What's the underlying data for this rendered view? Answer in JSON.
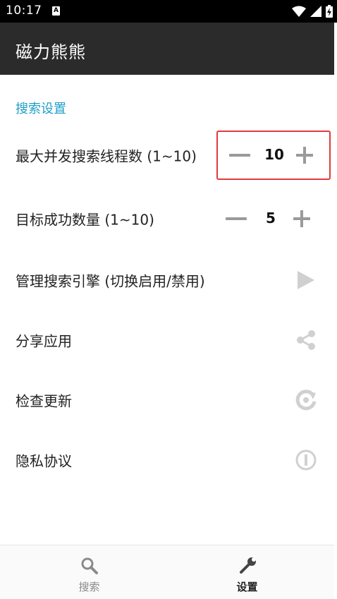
{
  "status_bar": {
    "time": "10:17",
    "badge": "A"
  },
  "app": {
    "title": "磁力熊熊"
  },
  "section": {
    "title": "搜索设置"
  },
  "settings": {
    "threads": {
      "label": "最大并发搜索线程数 (1~10)",
      "value": "10"
    },
    "targets": {
      "label": "目标成功数量 (1~10)",
      "value": "5"
    },
    "engines": {
      "label": "管理搜索引擎 (切换启用/禁用)",
      "icon": "play-icon"
    },
    "share": {
      "label": "分享应用",
      "icon": "share-icon"
    },
    "update": {
      "label": "检查更新",
      "icon": "refresh-icon"
    },
    "privacy": {
      "label": "隐私协议",
      "icon": "info-icon"
    }
  },
  "bottom_nav": {
    "search": {
      "label": "搜索",
      "icon": "search-icon"
    },
    "settings": {
      "label": "设置",
      "icon": "wrench-icon",
      "active": true
    }
  },
  "colors": {
    "accent": "#1ea0c8",
    "app_bar": "#2b2b2b",
    "highlight": "#e23a3a",
    "icon_gray": "#9a9a9a"
  }
}
